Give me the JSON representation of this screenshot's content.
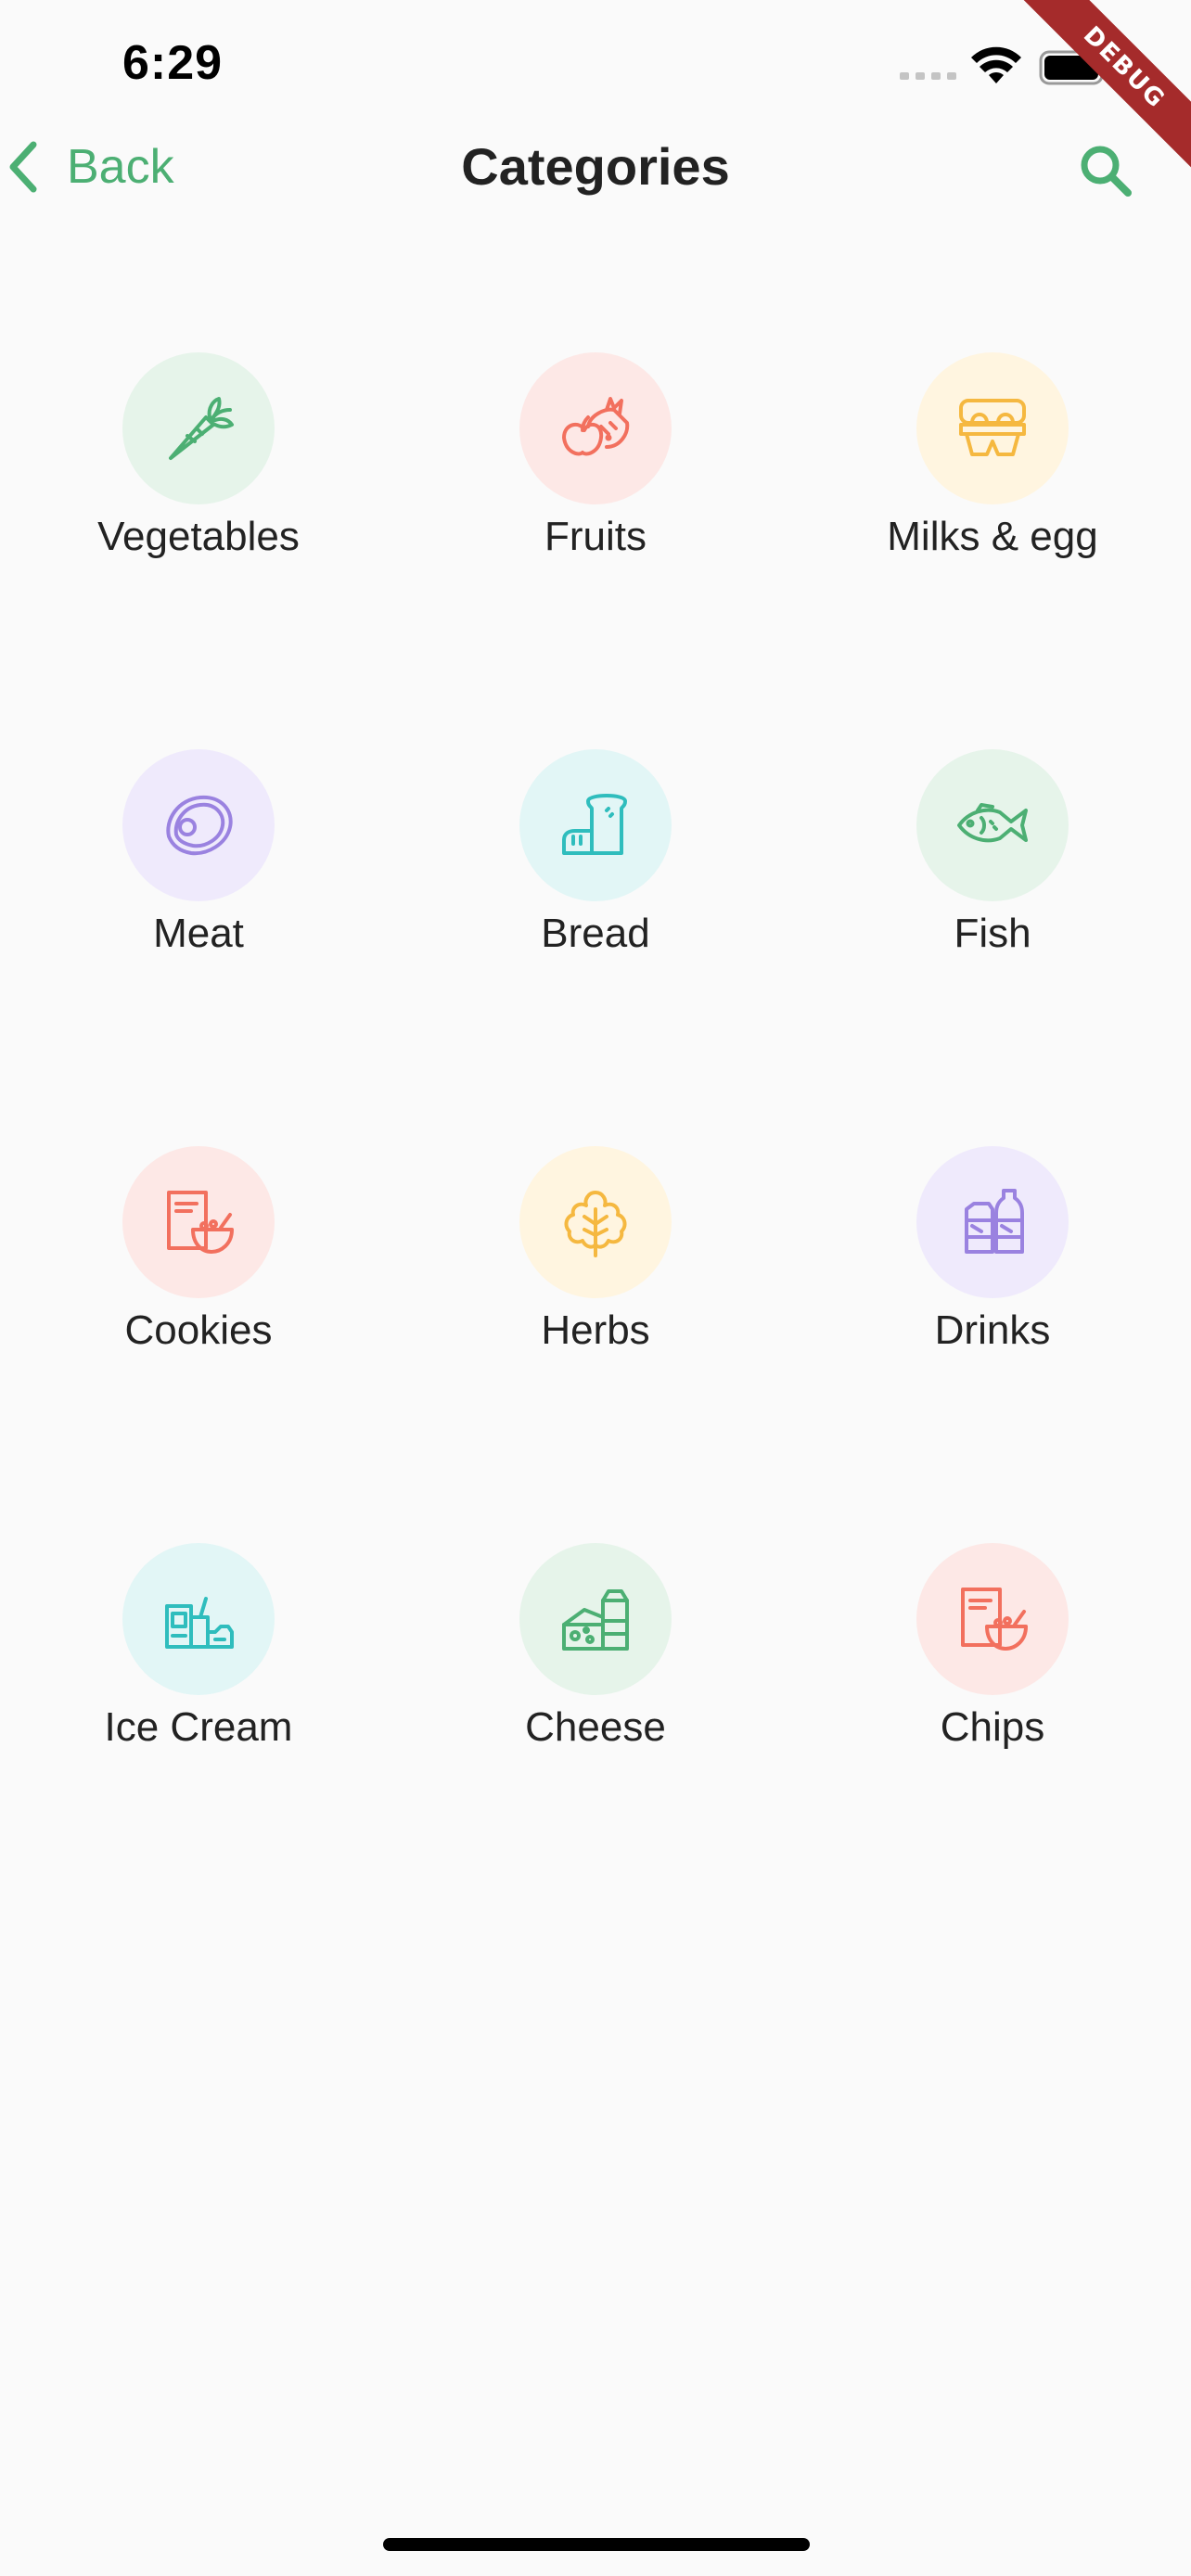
{
  "status_bar": {
    "time": "6:29"
  },
  "debug_banner": {
    "label": "DEBUG"
  },
  "nav": {
    "back_label": "Back",
    "title": "Categories",
    "accent_color": "#4caf73"
  },
  "categories": [
    {
      "label": "Vegetables",
      "icon": "carrot-icon",
      "bg": "#e6f4ea",
      "fg": "#4caf73"
    },
    {
      "label": "Fruits",
      "icon": "fruits-icon",
      "bg": "#fde8e6",
      "fg": "#f2705e"
    },
    {
      "label": "Milks & egg",
      "icon": "egg-carton-icon",
      "bg": "#fff5e0",
      "fg": "#f5b840"
    },
    {
      "label": "Meat",
      "icon": "steak-icon",
      "bg": "#efeafc",
      "fg": "#9a82e0"
    },
    {
      "label": "Bread",
      "icon": "bread-icon",
      "bg": "#e2f6f6",
      "fg": "#2fbdbd"
    },
    {
      "label": "Fish",
      "icon": "fish-icon",
      "bg": "#e6f4ea",
      "fg": "#4caf73"
    },
    {
      "label": "Cookies",
      "icon": "cereal-box-icon",
      "bg": "#fde8e6",
      "fg": "#f2705e"
    },
    {
      "label": "Herbs",
      "icon": "herb-leaf-icon",
      "bg": "#fff5e0",
      "fg": "#f5b840"
    },
    {
      "label": "Drinks",
      "icon": "bottles-icon",
      "bg": "#efeafc",
      "fg": "#9a82e0"
    },
    {
      "label": "Ice Cream",
      "icon": "ice-cream-icon",
      "bg": "#e2f6f6",
      "fg": "#2fbdbd"
    },
    {
      "label": "Cheese",
      "icon": "cheese-icon",
      "bg": "#e6f4ea",
      "fg": "#4caf73"
    },
    {
      "label": "Chips",
      "icon": "chips-icon",
      "bg": "#fde8e6",
      "fg": "#f2705e"
    }
  ]
}
